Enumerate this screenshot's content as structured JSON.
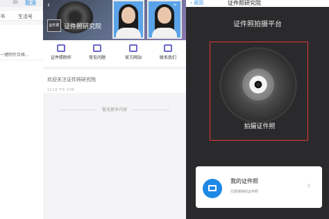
{
  "panel_left": {
    "cancel": "取消",
    "tabs": [
      "书",
      "生活号"
    ],
    "suggestion": "一键制作合格..."
  },
  "panel_middle": {
    "brand_logo": "证件照",
    "brand_name": "证件照研究院",
    "grid": [
      {
        "label": "证件照制作",
        "icon": "camera-icon"
      },
      {
        "label": "常见问题",
        "icon": "document-icon"
      },
      {
        "label": "官方网站",
        "icon": "browser-icon"
      },
      {
        "label": "联系我们",
        "icon": "chat-icon"
      }
    ],
    "post_title": "欢迎关注证件照研究院",
    "post_time": "12-15 下午 3:09",
    "no_more": "暂无更多内容"
  },
  "panel_right": {
    "back": "返回",
    "title": "证件照研究院",
    "platform": "证件照拍摄平台",
    "shoot_label": "拍摄证件照",
    "card_title": "我的证件照",
    "card_subtitle": "付费保存的证件照",
    "accent_color": "#e53935",
    "icon_color": "#1e88e5"
  }
}
